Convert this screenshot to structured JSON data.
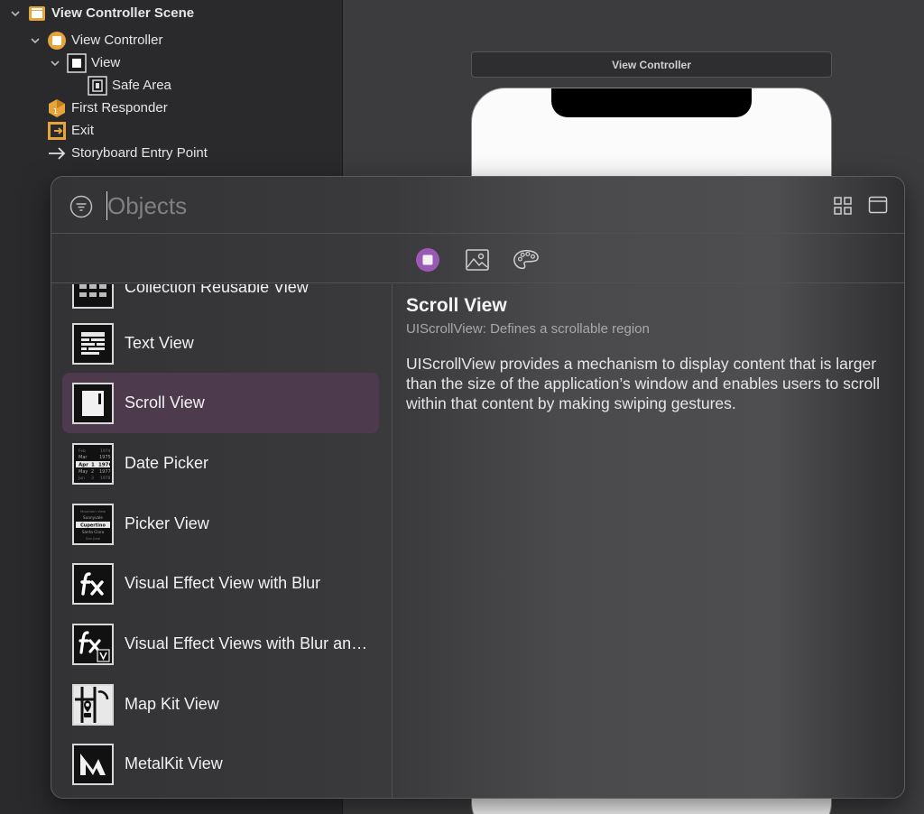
{
  "outline": {
    "items": [
      {
        "label": "View Controller Scene",
        "icon": "scene-icon",
        "chevron": true
      },
      {
        "label": "View Controller",
        "icon": "view-controller-icon",
        "chevron": true
      },
      {
        "label": "View",
        "icon": "view-icon",
        "chevron": true
      },
      {
        "label": "Safe Area",
        "icon": "safe-area-icon",
        "chevron": false
      },
      {
        "label": "First Responder",
        "icon": "first-responder-icon",
        "chevron": false
      },
      {
        "label": "Exit",
        "icon": "exit-icon",
        "chevron": false
      },
      {
        "label": "Storyboard Entry Point",
        "icon": "arrow-right-icon",
        "chevron": false
      }
    ]
  },
  "canvas": {
    "scene_title": "View Controller"
  },
  "library": {
    "search": {
      "placeholder": "Objects",
      "value": ""
    },
    "tabs": [
      {
        "name": "objects-tab",
        "icon": "objects-icon"
      },
      {
        "name": "media-tab",
        "icon": "image-icon"
      },
      {
        "name": "colors-tab",
        "icon": "palette-icon"
      }
    ],
    "items": [
      {
        "label": "Collection Reusable View",
        "icon": "collection-reusable-view-icon",
        "selected": false
      },
      {
        "label": "Text View",
        "icon": "text-view-icon",
        "selected": false
      },
      {
        "label": "Scroll View",
        "icon": "scroll-view-icon",
        "selected": true
      },
      {
        "label": "Date Picker",
        "icon": "date-picker-icon",
        "selected": false
      },
      {
        "label": "Picker View",
        "icon": "picker-view-icon",
        "selected": false
      },
      {
        "label": "Visual Effect View with Blur",
        "icon": "visual-effect-icon",
        "selected": false
      },
      {
        "label": "Visual Effect Views with Blur and Vibrancy",
        "icon": "visual-effect-vibrancy-icon",
        "selected": false
      },
      {
        "label": "Map Kit View",
        "icon": "map-kit-icon",
        "selected": false
      },
      {
        "label": "MetalKit View",
        "icon": "metalkit-icon",
        "selected": false
      }
    ],
    "detail": {
      "title": "Scroll View",
      "subtitle": "UIScrollView: Defines a scrollable region",
      "description": "UIScrollView provides a mechanism to display content that is larger than the size of the application’s window and enables users to scroll within that content by making swiping gestures."
    },
    "date_picker_icon": {
      "rows": [
        {
          "month": "Feb",
          "day": "",
          "year": "1974"
        },
        {
          "month": "Mar",
          "day": "",
          "year": "1975"
        },
        {
          "month": "Apr",
          "day": "1",
          "year": "1976"
        },
        {
          "month": "May",
          "day": "2",
          "year": "1977"
        },
        {
          "month": "Jun",
          "day": "3",
          "year": "1978"
        }
      ]
    },
    "picker_view_icon": {
      "rows": [
        "Mountain View",
        "Sunnyvale",
        "Cupertino",
        "Santa Clara",
        "San Jose"
      ]
    }
  },
  "colors": {
    "accent": "#9b59b6",
    "selection": "#4d3b4d",
    "outline_icon": "#e5a53b"
  }
}
